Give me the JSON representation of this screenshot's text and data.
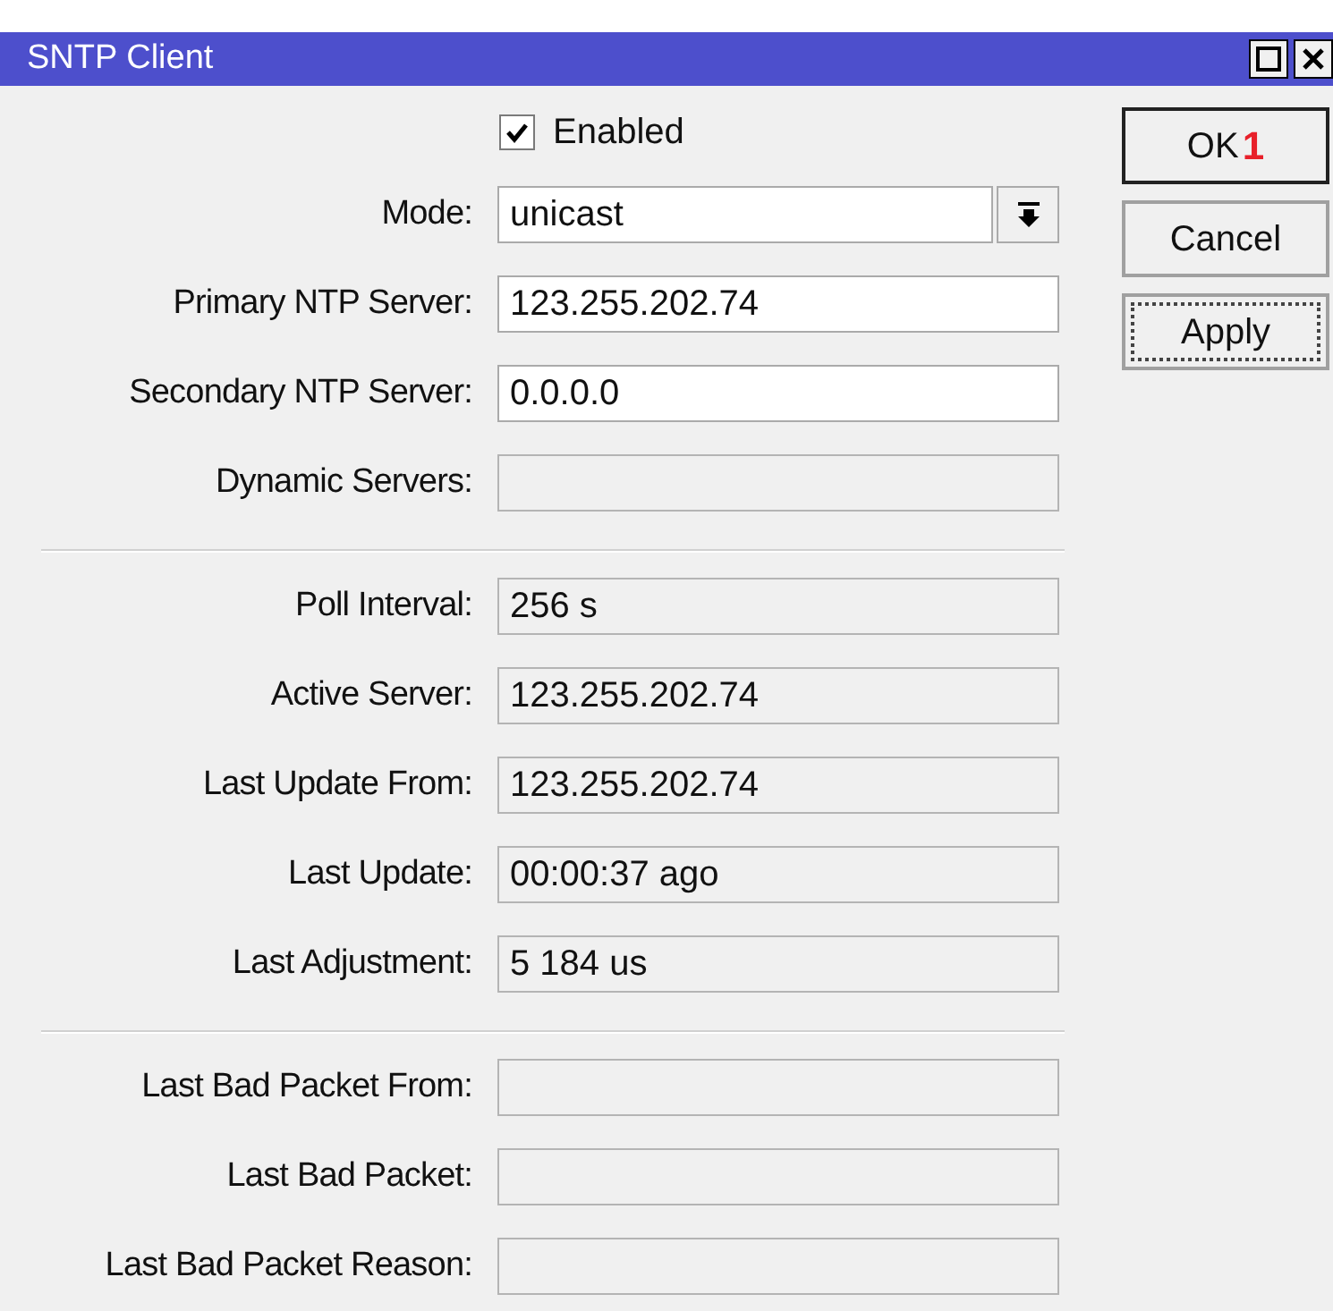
{
  "window": {
    "title": "SNTP Client"
  },
  "enabled": {
    "label": "Enabled",
    "checked": true
  },
  "sections": [
    {
      "fields": [
        {
          "kind": "dropdown",
          "label": "Mode:",
          "value": "unicast",
          "editable": true
        },
        {
          "kind": "text",
          "label": "Primary NTP Server:",
          "value": "123.255.202.74",
          "editable": true
        },
        {
          "kind": "text",
          "label": "Secondary NTP Server:",
          "value": "0.0.0.0",
          "editable": true
        },
        {
          "kind": "text",
          "label": "Dynamic Servers:",
          "editable": false
        }
      ]
    },
    {
      "fields": [
        {
          "kind": "text",
          "label": "Poll Interval:",
          "value": "256 s",
          "editable": false
        },
        {
          "kind": "text",
          "label": "Active Server:",
          "value": "123.255.202.74",
          "editable": false
        },
        {
          "kind": "text",
          "label": "Last Update From:",
          "value": "123.255.202.74",
          "editable": false
        },
        {
          "kind": "text",
          "label": "Last Update:",
          "value": "00:00:37 ago",
          "editable": false
        },
        {
          "kind": "text",
          "label": "Last Adjustment:",
          "value": "5 184 us",
          "editable": false
        }
      ]
    },
    {
      "fields": [
        {
          "kind": "text",
          "label": "Last Bad Packet From:",
          "editable": false
        },
        {
          "kind": "text",
          "label": "Last Bad Packet:",
          "editable": false
        },
        {
          "kind": "text",
          "label": "Last Bad Packet Reason:",
          "editable": false
        }
      ]
    }
  ],
  "buttons": [
    {
      "label": "OK",
      "badge": "1",
      "default": true,
      "focused": false
    },
    {
      "label": "Cancel",
      "default": false,
      "focused": false
    },
    {
      "label": "Apply",
      "default": false,
      "focused": true
    }
  ]
}
